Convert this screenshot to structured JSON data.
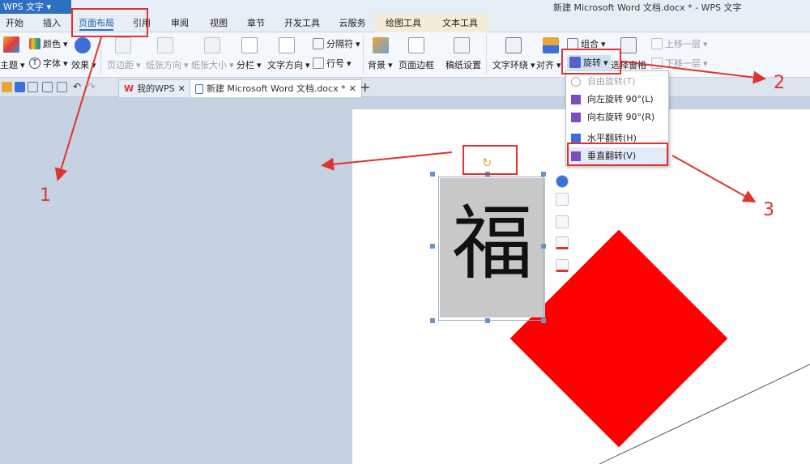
{
  "app": {
    "name": "WPS 文字",
    "window_title": "新建 Microsoft Word 文档.docx * - WPS 文字"
  },
  "menu_tabs": [
    "开始",
    "插入",
    "页面布局",
    "引用",
    "审阅",
    "视图",
    "章节",
    "开发工具",
    "云服务",
    "绘图工具",
    "文本工具"
  ],
  "ribbon": {
    "theme": "主题",
    "colors": "颜色",
    "fonts": "字体",
    "effects": "效果",
    "margins": "页边距",
    "orientation": "纸张方向",
    "size": "纸张大小",
    "columns": "分栏",
    "text_direction": "文字方向",
    "breaks": "分隔符",
    "line_numbers": "行号",
    "background": "背景",
    "page_border": "页面边框",
    "paper_setup": "稿纸设置",
    "wrap_text": "文字环绕",
    "align": "对齐",
    "group": "组合",
    "rotate": "旋转",
    "selection_pane": "选择窗格",
    "bring_forward": "上移一层",
    "send_backward": "下移一层"
  },
  "doc_tabs": [
    "我的WPS",
    "新建 Microsoft Word 文档.docx *"
  ],
  "rotate_menu": [
    {
      "label": "自由旋转(T)",
      "enabled": false
    },
    {
      "label": "向左旋转 90°(L)",
      "enabled": true
    },
    {
      "label": "向右旋转 90°(R)",
      "enabled": true
    },
    {
      "label": "水平翻转(H)",
      "enabled": true
    },
    {
      "label": "垂直翻转(V)",
      "enabled": true
    }
  ],
  "document": {
    "character": "福"
  },
  "annotations": [
    "1",
    "2",
    "3"
  ],
  "colors": {
    "accent": "#2f6fc0",
    "annotation": "#e0322e",
    "shape": "#ff0000"
  }
}
